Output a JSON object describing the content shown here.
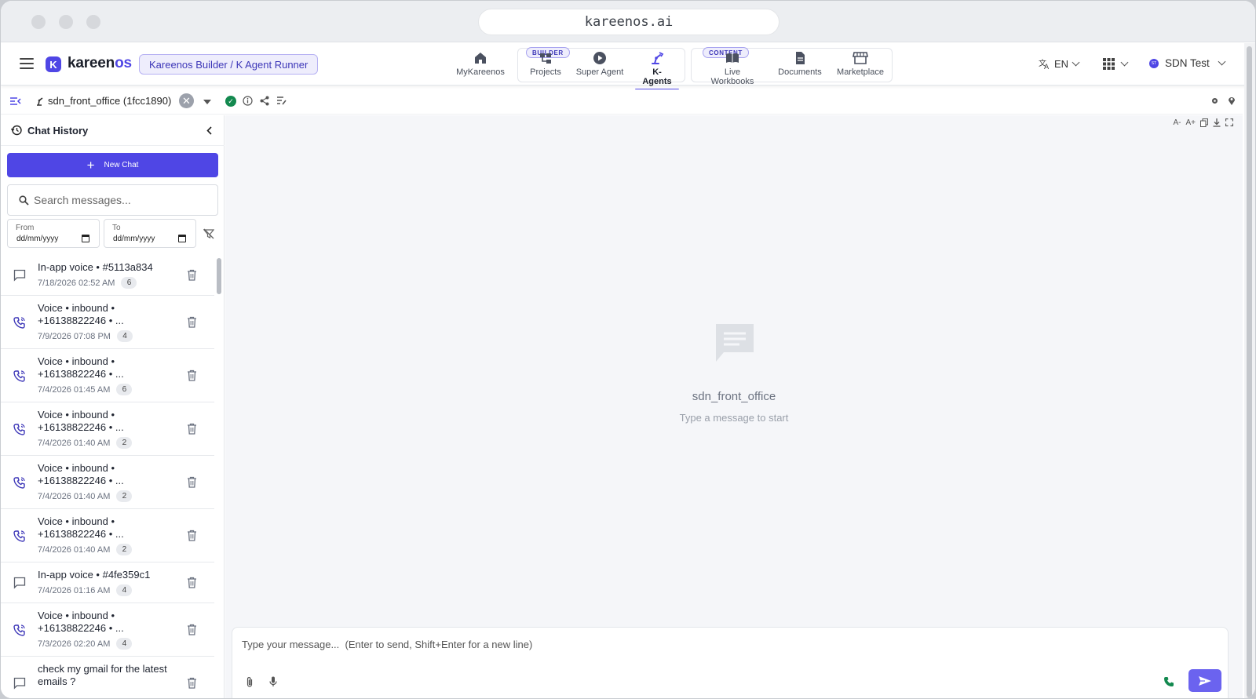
{
  "browser": {
    "url": "kareenos.ai"
  },
  "header": {
    "logo_text": "kareen",
    "logo_text_accent": "os",
    "logo_mark": "K",
    "context_badge": "Kareenos Builder / K Agent Runner",
    "nav": [
      {
        "label": "MyKareenos",
        "icon": "home-icon"
      },
      {
        "label": "Projects",
        "icon": "hierarchy-icon"
      },
      {
        "label": "Super Agent",
        "icon": "play-circle-icon"
      },
      {
        "label": "K-Agents",
        "icon": "robot-arm-icon"
      },
      {
        "label": "Live Workbooks",
        "icon": "book-icon"
      },
      {
        "label": "Documents",
        "icon": "document-icon"
      },
      {
        "label": "Marketplace",
        "icon": "store-icon"
      }
    ],
    "groups": {
      "builder": "BUILDER",
      "content": "CONTENT"
    },
    "language": "EN",
    "user": "SDN Test",
    "user_initials": "ST"
  },
  "toolbar": {
    "agent_name": "sdn_front_office (1fcc1890)"
  },
  "sidebar": {
    "title": "Chat History",
    "new_chat": "New Chat",
    "search_placeholder": "Search messages...",
    "from_label": "From",
    "to_label": "To",
    "date_placeholder": "dd/mm/yyyy",
    "chats": [
      {
        "title": "In-app voice • #5113a834",
        "time": "7/18/2026 02:52 AM",
        "count": "6",
        "type": "chat"
      },
      {
        "title": "Voice • inbound • +16138822246 • ...",
        "time": "7/9/2026 07:08 PM",
        "count": "4",
        "type": "phone"
      },
      {
        "title": "Voice • inbound • +16138822246 • ...",
        "time": "7/4/2026 01:45 AM",
        "count": "6",
        "type": "phone"
      },
      {
        "title": "Voice • inbound • +16138822246 • ...",
        "time": "7/4/2026 01:40 AM",
        "count": "2",
        "type": "phone"
      },
      {
        "title": "Voice • inbound • +16138822246 • ...",
        "time": "7/4/2026 01:40 AM",
        "count": "2",
        "type": "phone"
      },
      {
        "title": "Voice • inbound • +16138822246 • ...",
        "time": "7/4/2026 01:40 AM",
        "count": "2",
        "type": "phone"
      },
      {
        "title": "In-app voice • #4fe359c1",
        "time": "7/4/2026 01:16 AM",
        "count": "4",
        "type": "chat"
      },
      {
        "title": "Voice • inbound • +16138822246 • ...",
        "time": "7/3/2026 02:20 AM",
        "count": "4",
        "type": "phone"
      },
      {
        "title": "check my gmail for the latest emails ?",
        "time": "",
        "count": "",
        "type": "chat"
      }
    ]
  },
  "main": {
    "font_tools": [
      "A-",
      "A+"
    ],
    "empty_title": "sdn_front_office",
    "empty_subtitle": "Type a message to start",
    "composer_placeholder": "Type your message...  (Enter to send, Shift+Enter for a new line)"
  },
  "colors": {
    "accent": "#4f46e5",
    "success": "#13894f",
    "send": "#6b63ef"
  }
}
